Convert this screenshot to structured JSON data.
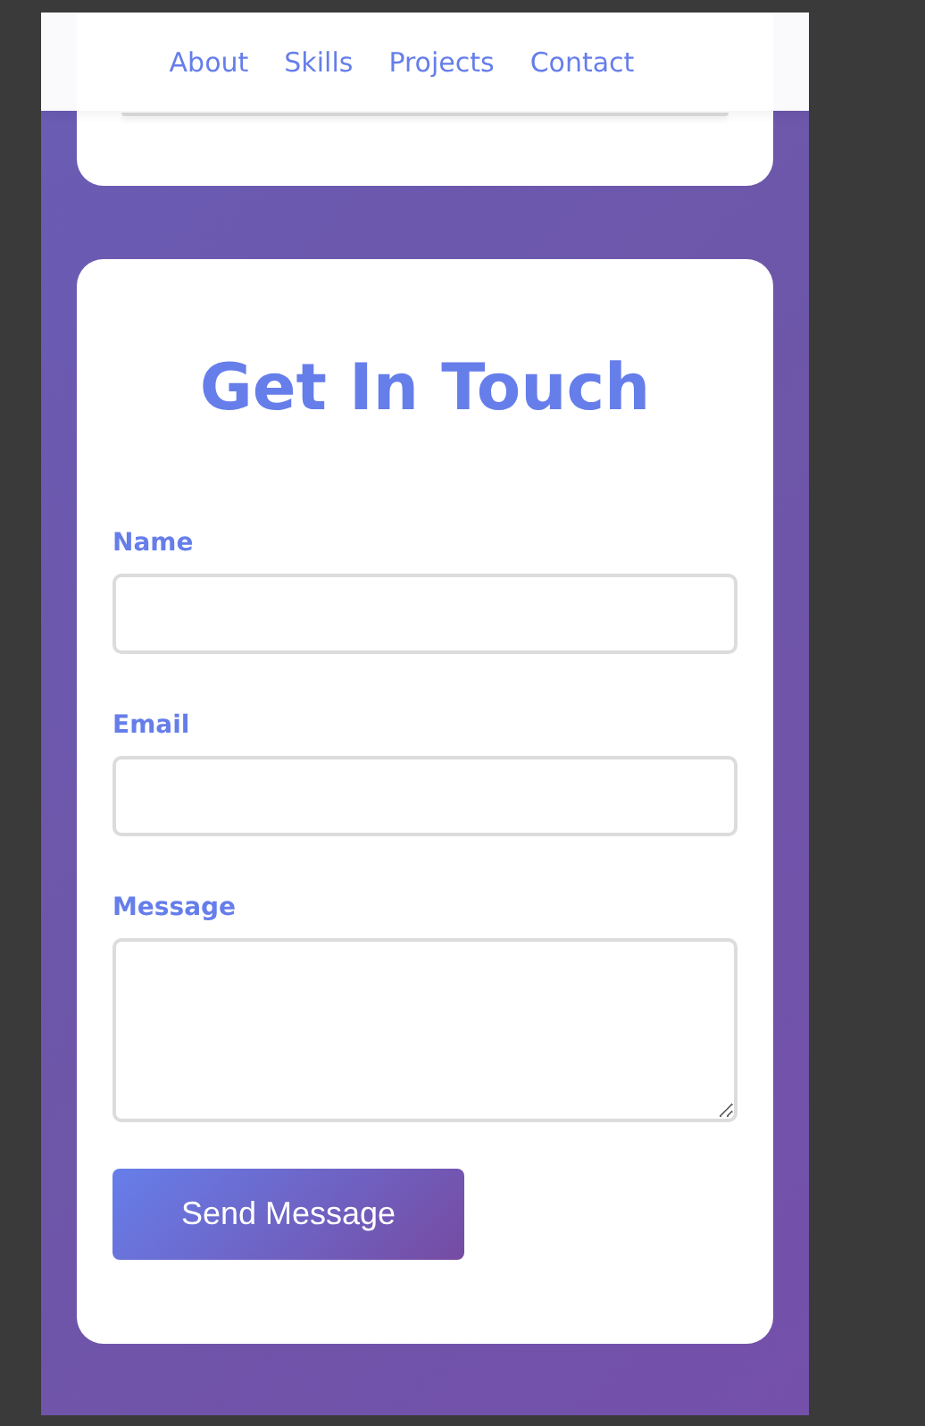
{
  "nav": {
    "links": [
      {
        "label": "About"
      },
      {
        "label": "Skills"
      },
      {
        "label": "Projects"
      },
      {
        "label": "Contact"
      }
    ]
  },
  "contact": {
    "title": "Get In Touch",
    "fields": [
      {
        "kind": "input",
        "label": "Name"
      },
      {
        "kind": "input",
        "label": "Email"
      },
      {
        "kind": "textarea",
        "label": "Message"
      }
    ],
    "button": "Send Message"
  }
}
